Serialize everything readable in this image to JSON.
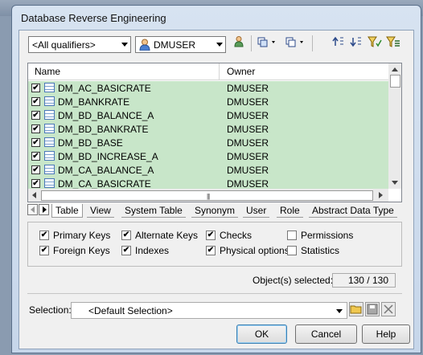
{
  "window": {
    "title": "Database Reverse Engineering"
  },
  "toolbar": {
    "qualifier": "<All qualifiers>",
    "owner": "DMUSER",
    "icons": [
      "select-user-icon",
      "select-all-icon",
      "deselect-all-icon",
      "move-up-icon",
      "move-down-icon",
      "filter-icon",
      "clear-filter-icon"
    ]
  },
  "list": {
    "columns": {
      "name": "Name",
      "owner": "Owner"
    },
    "rows": [
      {
        "name": "DM_AC_BASICRATE",
        "owner": "DMUSER",
        "checked": true
      },
      {
        "name": "DM_BANKRATE",
        "owner": "DMUSER",
        "checked": true
      },
      {
        "name": "DM_BD_BALANCE_A",
        "owner": "DMUSER",
        "checked": true
      },
      {
        "name": "DM_BD_BANKRATE",
        "owner": "DMUSER",
        "checked": true
      },
      {
        "name": "DM_BD_BASE",
        "owner": "DMUSER",
        "checked": true
      },
      {
        "name": "DM_BD_INCREASE_A",
        "owner": "DMUSER",
        "checked": true
      },
      {
        "name": "DM_CA_BALANCE_A",
        "owner": "DMUSER",
        "checked": true
      },
      {
        "name": "DM_CA_BASICRATE",
        "owner": "DMUSER",
        "checked": true
      }
    ],
    "row_color": "#c8e6c9"
  },
  "tabs": [
    "Table",
    "View",
    "System Table",
    "Synonym",
    "User",
    "Role",
    "Abstract Data Type"
  ],
  "active_tab": "Table",
  "options": {
    "primary_keys": {
      "label": "Primary Keys",
      "checked": true
    },
    "alternate_keys": {
      "label": "Alternate Keys",
      "checked": true
    },
    "checks": {
      "label": "Checks",
      "checked": true
    },
    "permissions": {
      "label": "Permissions",
      "checked": false
    },
    "foreign_keys": {
      "label": "Foreign Keys",
      "checked": true
    },
    "indexes": {
      "label": "Indexes",
      "checked": true
    },
    "physical_options": {
      "label": "Physical options",
      "checked": true
    },
    "statistics": {
      "label": "Statistics",
      "checked": false
    }
  },
  "status": {
    "label": "Object(s) selected:",
    "value": "130 / 130"
  },
  "selection": {
    "label": "Selection:",
    "value": "<Default Selection>"
  },
  "buttons": {
    "ok": "OK",
    "cancel": "Cancel",
    "help": "Help"
  }
}
